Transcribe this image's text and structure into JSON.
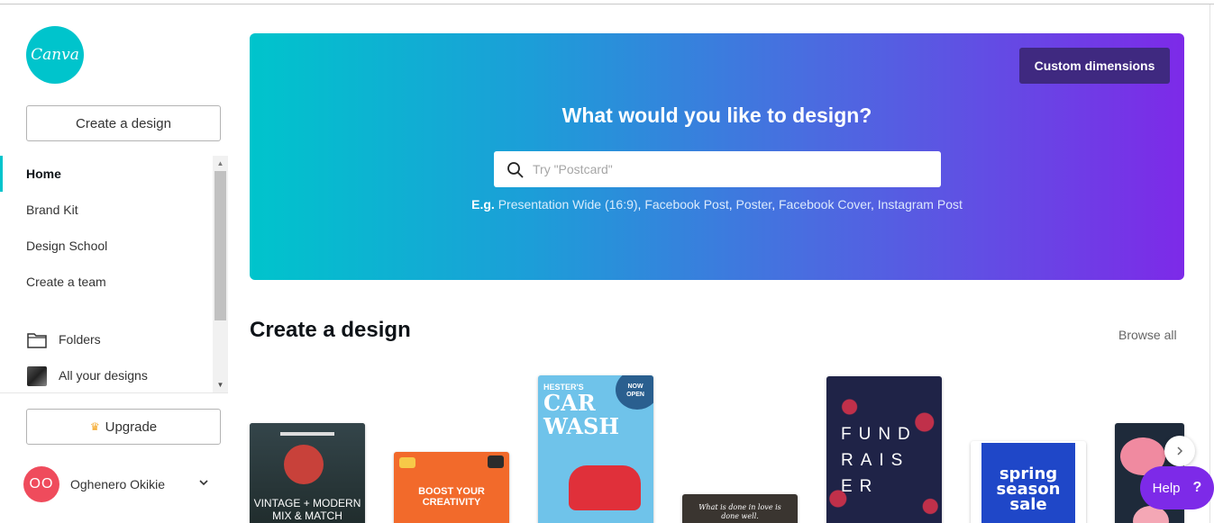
{
  "brand": {
    "logo_text": "Canva",
    "accent": "#00c4cc",
    "purple": "#7d2ae8"
  },
  "sidebar": {
    "create_label": "Create a design",
    "nav": [
      {
        "label": "Home",
        "active": true
      },
      {
        "label": "Brand Kit"
      },
      {
        "label": "Design School"
      },
      {
        "label": "Create a team"
      },
      {
        "label": "Folders",
        "icon": "folder-icon"
      },
      {
        "label": "All your designs",
        "icon": "thumbnail-icon"
      }
    ],
    "upgrade_label": "Upgrade",
    "user": {
      "initials": "OO",
      "name": "Oghenero Okikie"
    }
  },
  "hero": {
    "custom_dimensions_label": "Custom dimensions",
    "title": "What would you like to design?",
    "search_placeholder": "Try \"Postcard\"",
    "examples_prefix": "E.g.",
    "examples": [
      "Presentation Wide (16:9)",
      "Facebook Post",
      "Poster",
      "Facebook Cover",
      "Instagram Post"
    ]
  },
  "section": {
    "title": "Create a design",
    "browse_all": "Browse all",
    "cards": [
      {
        "name": "vintage-modern-card",
        "text": "VINTAGE + MODERN MIX & MATCH"
      },
      {
        "name": "boost-creativity-card",
        "text": "BOOST YOUR CREATIVITY"
      },
      {
        "name": "car-wash-card",
        "text_top": "HESTER'S",
        "text_main": "CAR WASH",
        "badge": "NOW OPEN"
      },
      {
        "name": "quote-card",
        "text": "What is done in love is done well."
      },
      {
        "name": "fundraiser-card",
        "text": "FUND RAIS ER"
      },
      {
        "name": "spring-sale-card",
        "text": "spring season sale"
      },
      {
        "name": "floral-card",
        "text": ""
      }
    ]
  },
  "help": {
    "label": "Help",
    "icon": "?"
  }
}
